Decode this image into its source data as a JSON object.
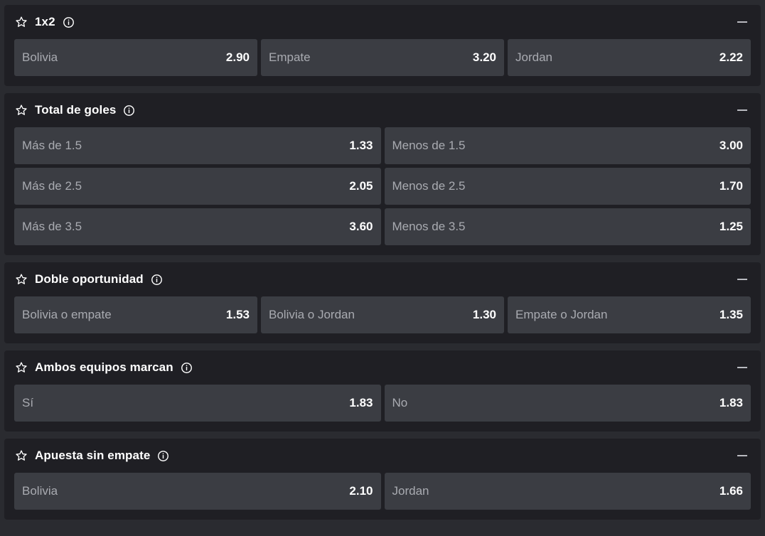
{
  "markets": [
    {
      "title": "1x2",
      "columns": 3,
      "odds": [
        {
          "label": "Bolivia",
          "value": "2.90"
        },
        {
          "label": "Empate",
          "value": "3.20"
        },
        {
          "label": "Jordan",
          "value": "2.22"
        }
      ]
    },
    {
      "title": "Total de goles",
      "columns": 2,
      "odds": [
        {
          "label": "Más de 1.5",
          "value": "1.33"
        },
        {
          "label": "Menos de 1.5",
          "value": "3.00"
        },
        {
          "label": "Más de 2.5",
          "value": "2.05"
        },
        {
          "label": "Menos de 2.5",
          "value": "1.70"
        },
        {
          "label": "Más de 3.5",
          "value": "3.60"
        },
        {
          "label": "Menos de 3.5",
          "value": "1.25"
        }
      ]
    },
    {
      "title": "Doble oportunidad",
      "columns": 3,
      "odds": [
        {
          "label": "Bolivia o empate",
          "value": "1.53"
        },
        {
          "label": "Bolivia o Jordan",
          "value": "1.30"
        },
        {
          "label": "Empate o Jordan",
          "value": "1.35"
        }
      ]
    },
    {
      "title": "Ambos equipos marcan",
      "columns": 2,
      "odds": [
        {
          "label": "Sí",
          "value": "1.83"
        },
        {
          "label": "No",
          "value": "1.83"
        }
      ]
    },
    {
      "title": "Apuesta sin empate",
      "columns": 2,
      "odds": [
        {
          "label": "Bolivia",
          "value": "2.10"
        },
        {
          "label": "Jordan",
          "value": "1.66"
        }
      ]
    }
  ],
  "icons": {
    "favorite": "star-outline-icon",
    "info": "info-circle-icon",
    "collapse": "minus-icon"
  },
  "colors": {
    "page_background": "#2a2b30",
    "panel_background": "#1f1f24",
    "odd_background": "#3b3d43",
    "label_text": "#a9abb1",
    "value_text": "#ffffff"
  }
}
